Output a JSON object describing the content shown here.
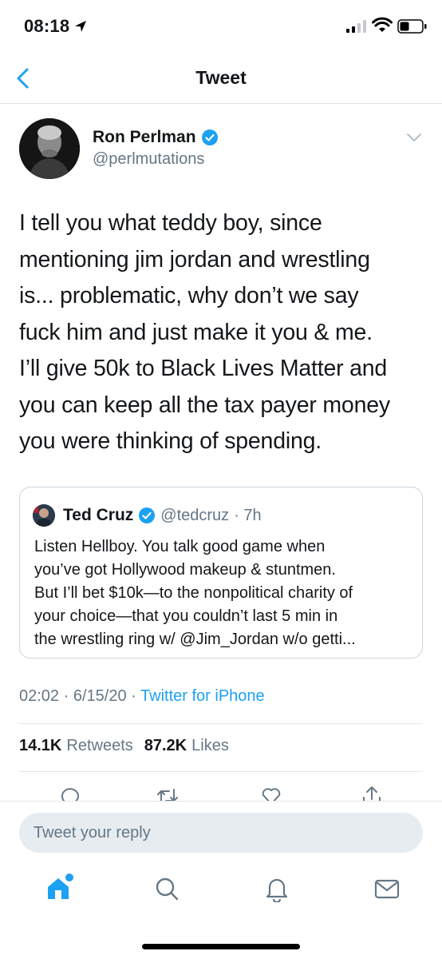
{
  "status": {
    "time": "08:18"
  },
  "nav": {
    "title": "Tweet"
  },
  "author": {
    "name": "Ron Perlman",
    "handle": "@perlmutations"
  },
  "tweet": {
    "lines": [
      "I tell you what teddy boy, since",
      "mentioning jim jordan and wrestling",
      "is... problematic, why don’t we say",
      "fuck him and just make it you & me.",
      "I’ll give 50k to Black Lives Matter and",
      "you can keep all the tax payer money",
      "you were thinking of spending."
    ]
  },
  "quote": {
    "name": "Ted Cruz",
    "handle": "@tedcruz",
    "time": "· 7h",
    "lines": [
      "Listen Hellboy. You talk good game when",
      "you’ve got Hollywood makeup & stuntmen.",
      "But I’ll bet $10k—to the nonpolitical charity of",
      "your choice—that you couldn’t last 5 min in",
      "the wrestling ring w/ @Jim_Jordan w/o getti..."
    ]
  },
  "meta": {
    "time": "02:02",
    "date": "6/15/20",
    "separator": "·",
    "source": "Twitter for iPhone"
  },
  "stats": {
    "retweets_count": "14.1K",
    "retweets_label": "Retweets",
    "likes_count": "87.2K",
    "likes_label": "Likes"
  },
  "reply": {
    "placeholder": "Tweet your reply"
  },
  "colors": {
    "accent": "#1da1f2",
    "secondary_text": "#657786",
    "divider": "#e1e8ed"
  },
  "icons": [
    "location-arrow-icon",
    "signal-icon",
    "wifi-icon",
    "battery-icon",
    "back-chevron-icon",
    "verified-badge-icon",
    "chevron-down-icon",
    "reply-icon",
    "retweet-icon",
    "like-icon",
    "share-icon",
    "home-icon",
    "search-icon",
    "notifications-icon",
    "messages-icon"
  ]
}
